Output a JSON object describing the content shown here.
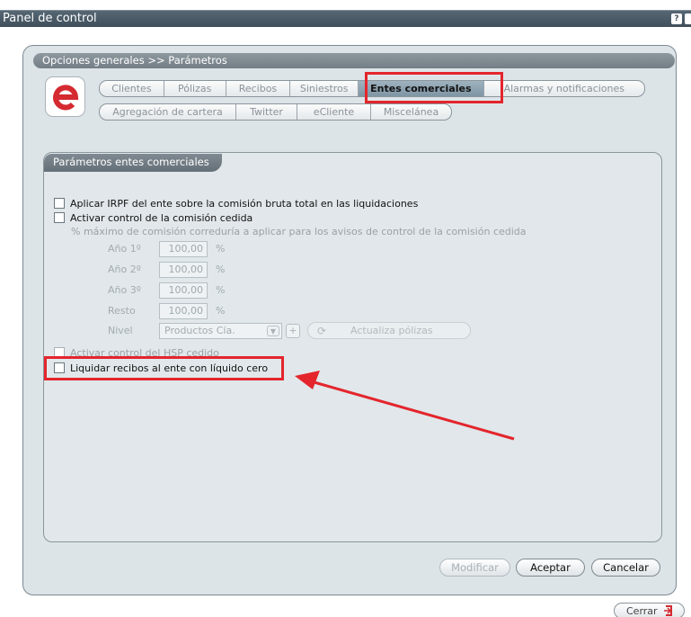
{
  "window": {
    "title": "Panel de control",
    "help_label": "?"
  },
  "breadcrumb": "Opciones generales >> Parámetros",
  "logo_letter": "e",
  "tabs_row1": [
    {
      "label": "Clientes",
      "active": false
    },
    {
      "label": "Pólizas",
      "active": false
    },
    {
      "label": "Recibos",
      "active": false
    },
    {
      "label": "Siniestros",
      "active": false
    },
    {
      "label": "Entes comerciales",
      "active": true
    },
    {
      "label": "Alarmas y notificaciones",
      "active": false
    }
  ],
  "tabs_row2": [
    {
      "label": "Agregación de cartera"
    },
    {
      "label": "Twitter"
    },
    {
      "label": "eCliente"
    },
    {
      "label": "Miscelánea"
    }
  ],
  "section": {
    "title": "Parámetros entes comerciales",
    "check_irpf": "Aplicar IRPF del ente sobre la comisión bruta total en las liquidaciones",
    "check_control": "Activar control de la comisión cedida",
    "note": "% máximo de comisión correduría a aplicar para los avisos de control de la comisión cedida",
    "years": [
      {
        "label": "Año 1º",
        "value": "100,00",
        "unit": "%"
      },
      {
        "label": "Año 2º",
        "value": "100,00",
        "unit": "%"
      },
      {
        "label": "Año 3º",
        "value": "100,00",
        "unit": "%"
      },
      {
        "label": "Resto",
        "value": "100,00",
        "unit": "%"
      }
    ],
    "nivel_label": "Nivel",
    "nivel_value": "Productos Cía.",
    "update_button": "Actualiza pólizas",
    "check_hsp": "Activar control del HSP cedido",
    "check_liquidar": "Liquidar recibos al ente con líquido cero"
  },
  "buttons": {
    "modificar": "Modificar",
    "aceptar": "Aceptar",
    "cancelar": "Cancelar"
  },
  "close_button": "Cerrar",
  "colors": {
    "highlight": "#e4252c",
    "logo": "#d42a30",
    "active_tab": "#8ea2b0"
  }
}
